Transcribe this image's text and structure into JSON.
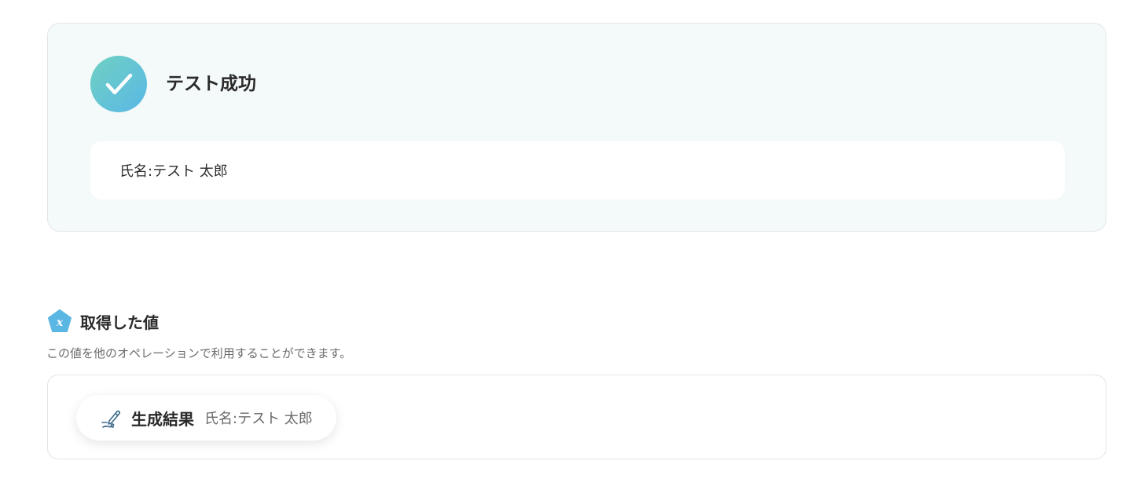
{
  "test_result": {
    "status_title": "テスト成功",
    "output_text": "氏名:テスト 太郎",
    "icon": "check-icon",
    "accent_gradient": [
      "#6fd1c2",
      "#5ab8e6"
    ]
  },
  "acquired_values": {
    "title": "取得した値",
    "description": "この値を他のオペレーションで利用することができます。",
    "icon": "variable-icon",
    "items": [
      {
        "label": "生成結果",
        "value": "氏名:テスト 太郎",
        "icon": "pen-icon"
      }
    ]
  }
}
